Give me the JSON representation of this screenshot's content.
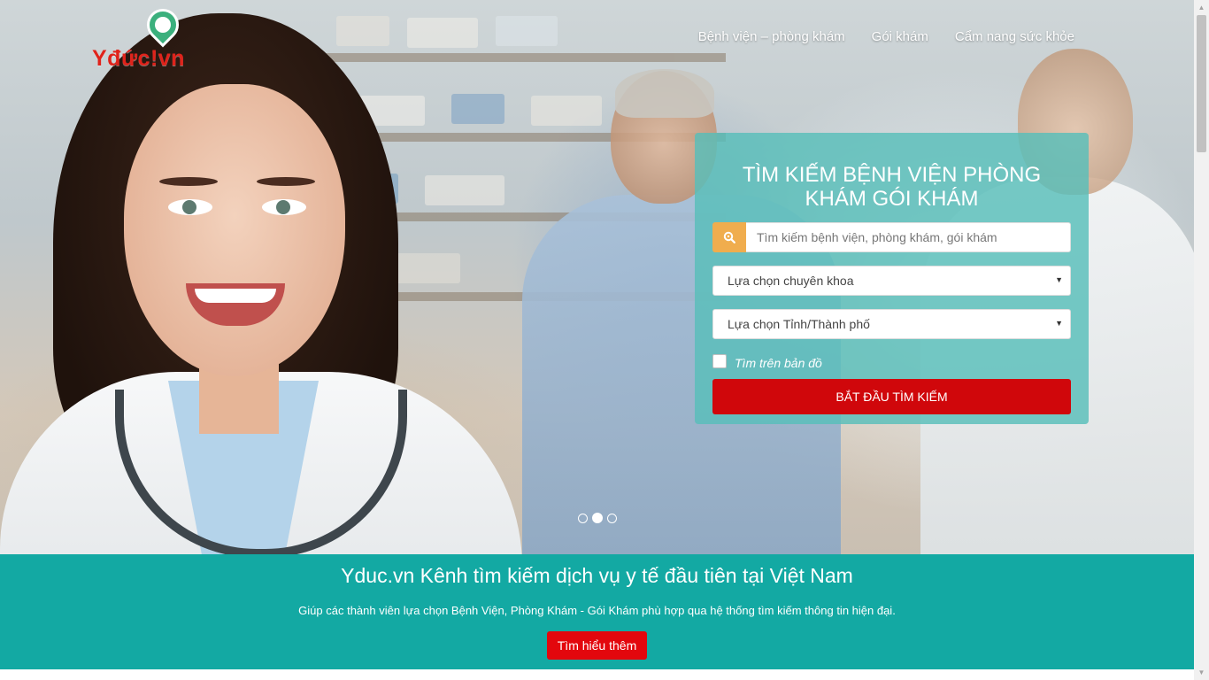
{
  "header": {
    "logo_text": "Yđức!vn",
    "nav": [
      {
        "label": "Bệnh viện – phòng khám"
      },
      {
        "label": "Gói khám"
      },
      {
        "label": "Cẩm nang sức khỏe"
      }
    ]
  },
  "search_panel": {
    "title": "TÌM KIẾM BỆNH VIỆN PHÒNG KHÁM GÓI KHÁM",
    "search_placeholder": "Tìm kiếm bệnh viện, phòng khám, gói khám",
    "specialty_select": "Lựa chọn chuyên khoa",
    "province_select": "Lựa chọn Tỉnh/Thành phố",
    "map_checkbox_label": "Tìm trên bản đồ",
    "map_checkbox_checked": false,
    "submit_label": "BẮT ĐẦU TÌM KIẾM"
  },
  "carousel": {
    "slide_count": 3,
    "active_index": 1
  },
  "banner": {
    "title": "Yduc.vn Kênh tìm kiếm dịch vụ y tế đầu tiên tại Việt Nam",
    "subtitle": "Giúp các thành viên lựa chọn Bệnh Viện, Phòng Khám - Gói Khám phù hợp qua hệ thống tìm kiếm thông tin hiện đại.",
    "button_label": "Tìm hiểu thêm"
  },
  "colors": {
    "brand_red": "#e0231b",
    "teal": "#13a9a3",
    "button_red": "#d0070b",
    "search_icon_bg": "#f0ad4e"
  },
  "icons": {
    "search": "search-icon",
    "dropdown": "chevron-down-icon",
    "logo_pin": "stethoscope-pin-icon"
  }
}
